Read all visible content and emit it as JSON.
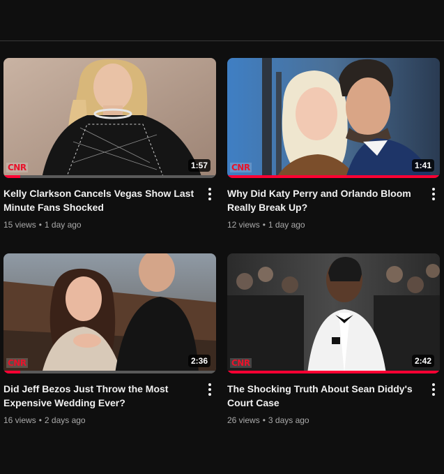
{
  "accent_color": "#ff0033",
  "videos": [
    {
      "title": "Kelly Clarkson Cancels Vegas Show Last Minute Fans Shocked",
      "views": "15 views",
      "age": "1 day ago",
      "duration": "1:57",
      "channel_logo": "CNR",
      "watch_progress": 0.08
    },
    {
      "title": "Why Did Katy Perry and Orlando Bloom Really Break Up?",
      "views": "12 views",
      "age": "1 day ago",
      "duration": "1:41",
      "channel_logo": "CNR",
      "watch_progress": 1.0
    },
    {
      "title": "Did Jeff Bezos Just Throw the Most Expensive Wedding Ever?",
      "views": "16 views",
      "age": "2 days ago",
      "duration": "2:36",
      "channel_logo": "CNR",
      "watch_progress": 0.08
    },
    {
      "title": "The Shocking Truth About Sean Diddy's Court Case",
      "views": "26 views",
      "age": "3 days ago",
      "duration": "2:42",
      "channel_logo": "CNR",
      "watch_progress": 1.0
    }
  ],
  "separator": "•",
  "more_icon": "vertical-ellipsis-icon"
}
